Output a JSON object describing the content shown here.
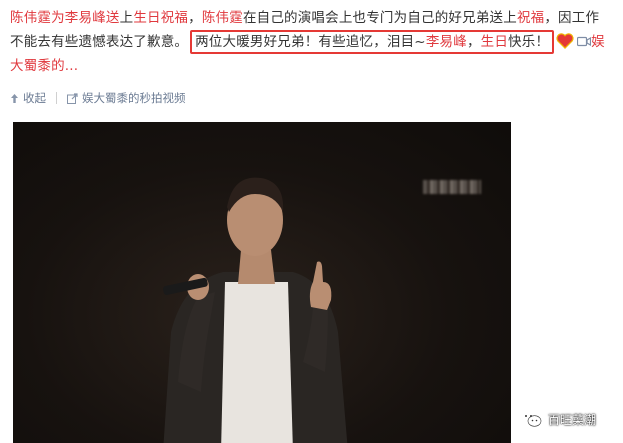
{
  "post": {
    "line1": {
      "s1": "陈伟霆为李易峰送",
      "s2": "上",
      "s3": "生日祝福",
      "s4": "，",
      "s5": "陈伟霆",
      "s6": "在自己的演唱会上也专门为自己的好兄弟送上",
      "s7": "祝福",
      "s8": "，因工作"
    },
    "line2": {
      "s1": "不能去有些遗憾表达了歉意。",
      "q1": "两位大暖男好兄弟！有些追忆，泪目~",
      "q2": "李易峰",
      "q3": "，",
      "q4": "生日",
      "q5": "快乐！",
      "suffix": "娱"
    },
    "line3": {
      "author": "大蜀黍的..."
    }
  },
  "actions": {
    "collect_label": "收起",
    "video_link_label": "娱大蜀黍的秒拍视频"
  },
  "watermark": {
    "label": "百旺菜潮"
  },
  "icons": {
    "heart": "heart-icon",
    "video": "video-icon",
    "collect": "arrow-up-icon",
    "external": "external-link-icon",
    "wechat": "wechat-icon"
  },
  "colors": {
    "highlight": "#e0393e",
    "box": "#e53935",
    "action": "#6b7b93",
    "video_bg": "#1b1512"
  }
}
